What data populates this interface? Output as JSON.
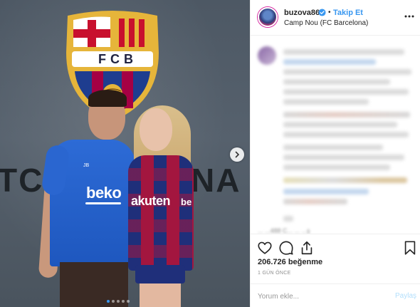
{
  "photo": {
    "wall_text_left": "TCE",
    "wall_text_right": "NA",
    "crest_text": "FCB",
    "shirt_sponsor_1": "beko",
    "shirt_sponsor_2": "akuten",
    "shirt_sponsor_3": "be",
    "shirt_initials": "JB",
    "carousel_dots": 5,
    "carousel_active_index": 0
  },
  "header": {
    "username": "buzova86",
    "bullet": "•",
    "follow_label": "Takip Et",
    "location": "Camp Nou (FC Barcelona)"
  },
  "comments": {
    "partial_text": "... ...488 C... ... ...ş"
  },
  "actions": {
    "likes": "206.726 beğenme",
    "time": "1 GÜN ÖNCE"
  },
  "comment_box": {
    "placeholder": "Yorum ekle...",
    "post_label": "Paylaş"
  },
  "colors": {
    "accent": "#3897f0",
    "text": "#262626",
    "muted": "#8e8e8e",
    "divider": "#efefef"
  }
}
